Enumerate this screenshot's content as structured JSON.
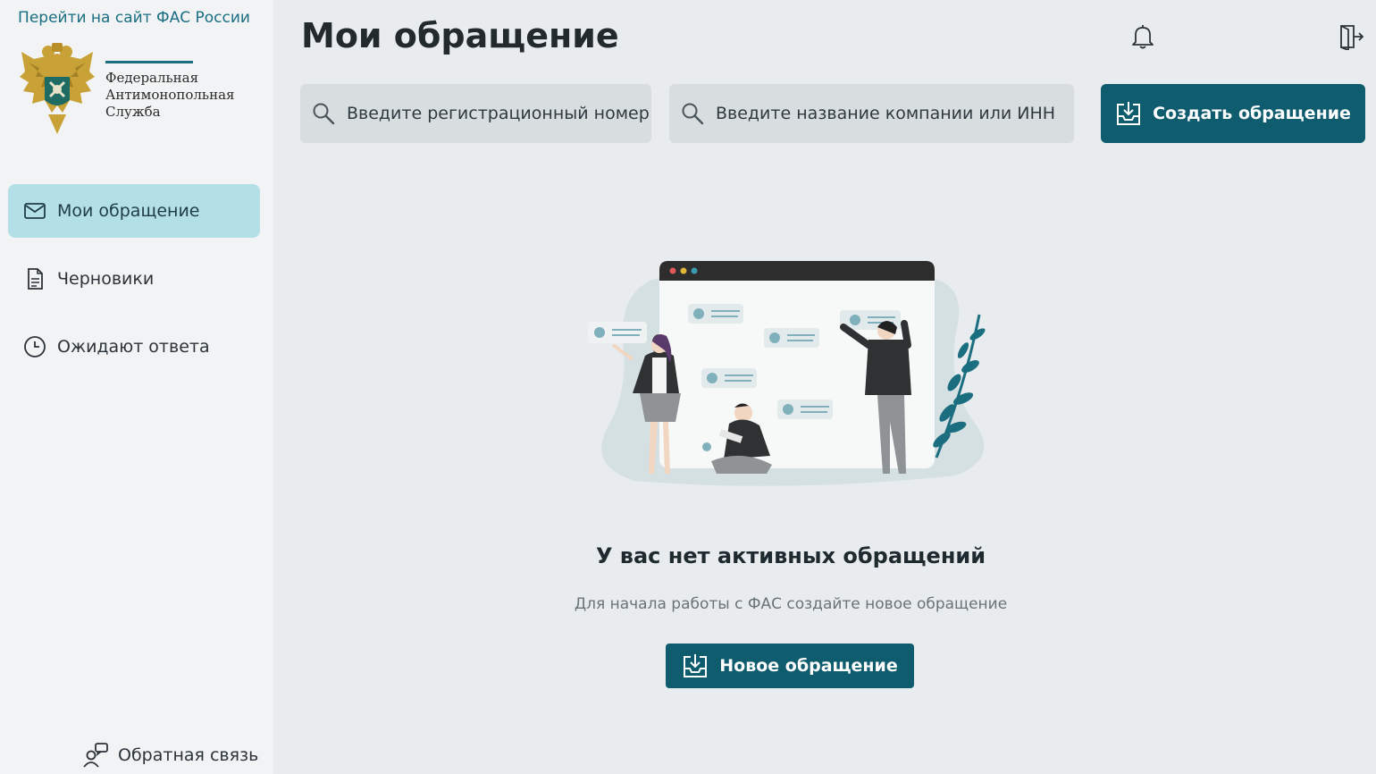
{
  "sidebar": {
    "fas_link": "Перейти на сайт ФАС России",
    "org_name": [
      "Федеральная",
      "Антимонопольная",
      "Служба"
    ],
    "nav": [
      {
        "label": "Мои обращение",
        "icon": "mail-icon",
        "active": true
      },
      {
        "label": "Черновики",
        "icon": "document-icon",
        "active": false
      },
      {
        "label": "Ожидают ответа",
        "icon": "clock-icon",
        "active": false
      }
    ],
    "feedback_label": "Обратная связь"
  },
  "header": {
    "title": "Мои обращение",
    "notification_icon": "bell-icon",
    "logout_icon": "logout-icon"
  },
  "toolbar": {
    "search_reg_placeholder": "Введите регистрационный номер",
    "search_company_placeholder": "Введите название компании или ИНН",
    "create_label": "Создать обращение"
  },
  "empty_state": {
    "title": "У вас нет активных обращений",
    "subtitle": "Для начала работы с ФАС создайте новое обращение",
    "button_label": "Новое обращение"
  },
  "colors": {
    "accent": "#0f5c6e",
    "active_nav": "#b3dfe6",
    "link": "#1a6e82",
    "background": "#e8ecee"
  }
}
